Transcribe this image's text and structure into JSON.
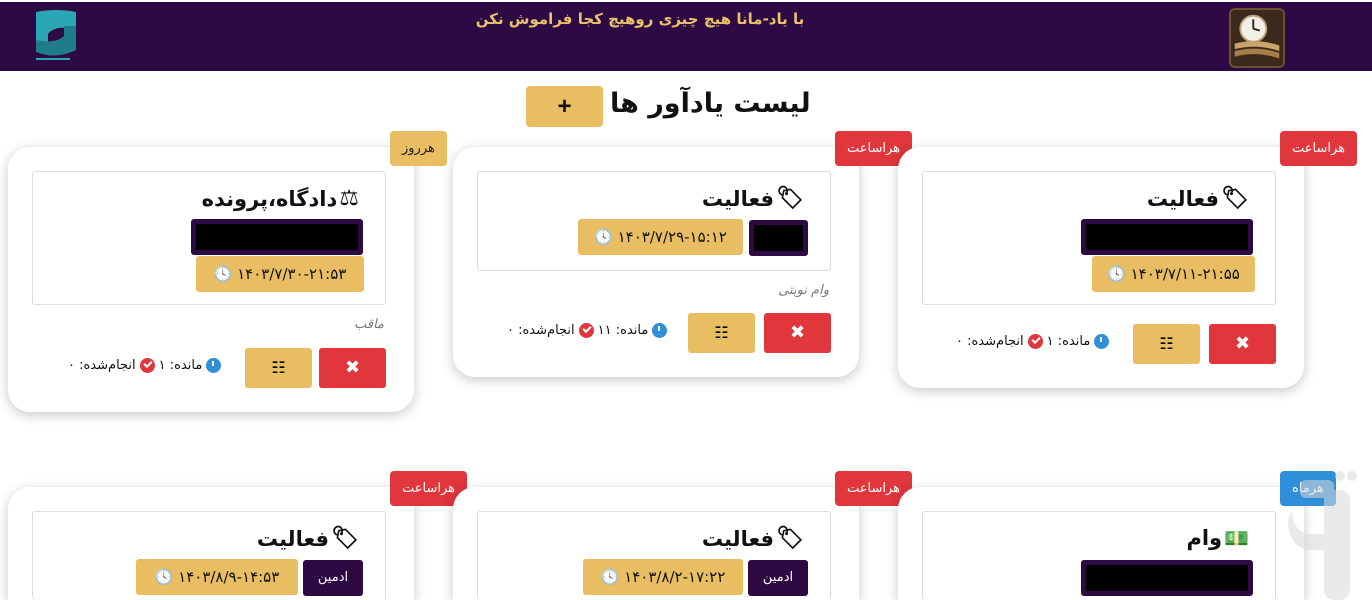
{
  "header": {
    "slogan": "با یاد-مانا هیچ چیزی روهیچ کجا فراموش نکن",
    "logo_icon": "site-logo-icon",
    "app_icon": "clock-wallet-icon"
  },
  "page": {
    "title": "لیست یادآور ها",
    "add_label": "+"
  },
  "cards": [
    {
      "badge": "هرروز",
      "title": "دادگاه،پرونده",
      "title_icon": "scale-icon",
      "date": "۱۴۰۳/۷/۳۰-۲۱:۵۳",
      "note": "ماقب",
      "remaining_label": "مانده: ۱",
      "done_label": "انجام‌شده: ۰",
      "delete_label": "✖",
      "list_label": "☷"
    },
    {
      "badge": "هراساعت",
      "title": "فعالیت",
      "title_icon": "tags-icon",
      "date": "۱۴۰۳/۷/۲۹-۱۵:۱۲",
      "note": "وام نوبتی",
      "remaining_label": "مانده: ۱۱",
      "done_label": "انجام‌شده: ۰",
      "delete_label": "✖",
      "list_label": "☷"
    },
    {
      "badge": "هراساعت",
      "title": "فعالیت",
      "title_icon": "tags-icon",
      "date": "۱۴۰۳/۷/۱۱-۲۱:۵۵",
      "remaining_label": "مانده: ۱",
      "done_label": "انجام‌شده: ۰",
      "delete_label": "✖",
      "list_label": "☷"
    },
    {
      "badge": "هراساعت",
      "title": "فعالیت",
      "title_icon": "tags-icon",
      "date": "۱۴۰۳/۸/۹-۱۴:۵۳",
      "admin": "ادمین"
    },
    {
      "badge": "هراساعت",
      "title": "فعالیت",
      "title_icon": "tags-icon",
      "date": "۱۴۰۳/۸/۲-۱۷:۲۲",
      "admin": "ادمین"
    },
    {
      "badge": "هرماه",
      "title": "وام",
      "title_icon": "money-bill-icon"
    }
  ],
  "watermark": "parsi-app-store-icon",
  "colors": {
    "header_bg": "#2e0a45",
    "accent_gold": "#e9be62",
    "danger_red": "#e0363c",
    "info_blue": "#2f8fd8"
  }
}
